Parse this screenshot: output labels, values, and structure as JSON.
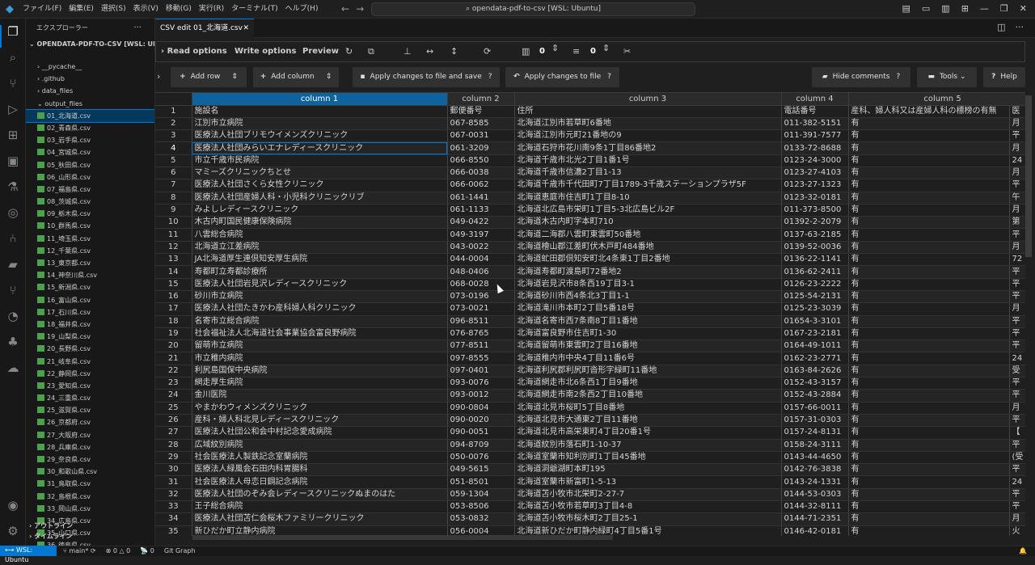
{
  "titlebar": {
    "menu": [
      "ファイル(F)",
      "編集(E)",
      "選択(S)",
      "表示(V)",
      "移動(G)",
      "実行(R)",
      "ターミナル(T)",
      "ヘルプ(H)"
    ],
    "search": "opendata-pdf-to-csv [WSL: Ubuntu]"
  },
  "sidebar": {
    "title": "エクスプローラー",
    "project": "OPENDATA-PDF-TO-CSV [WSL: UBUNT...",
    "items": [
      {
        "label": "__pycache__",
        "type": "folder"
      },
      {
        "label": ".github",
        "type": "folder"
      },
      {
        "label": "data_files",
        "type": "folder"
      },
      {
        "label": "output_files",
        "type": "folder-open"
      },
      {
        "label": "01_北海道.csv",
        "type": "csv",
        "selected": true
      },
      {
        "label": "02_青森県.csv",
        "type": "csv"
      },
      {
        "label": "03_岩手県.csv",
        "type": "csv"
      },
      {
        "label": "04_宮城県.csv",
        "type": "csv"
      },
      {
        "label": "05_秋田県.csv",
        "type": "csv"
      },
      {
        "label": "06_山形県.csv",
        "type": "csv"
      },
      {
        "label": "07_福島県.csv",
        "type": "csv"
      },
      {
        "label": "08_茨城県.csv",
        "type": "csv"
      },
      {
        "label": "09_栃木県.csv",
        "type": "csv"
      },
      {
        "label": "10_群馬県.csv",
        "type": "csv"
      },
      {
        "label": "11_埼玉県.csv",
        "type": "csv"
      },
      {
        "label": "12_千葉県.csv",
        "type": "csv"
      },
      {
        "label": "13_東京都.csv",
        "type": "csv"
      },
      {
        "label": "14_神奈川県.csv",
        "type": "csv"
      },
      {
        "label": "15_新潟県.csv",
        "type": "csv"
      },
      {
        "label": "16_富山県.csv",
        "type": "csv"
      },
      {
        "label": "17_石川県.csv",
        "type": "csv"
      },
      {
        "label": "18_福井県.csv",
        "type": "csv"
      },
      {
        "label": "19_山梨県.csv",
        "type": "csv"
      },
      {
        "label": "20_長野県.csv",
        "type": "csv"
      },
      {
        "label": "21_岐阜県.csv",
        "type": "csv"
      },
      {
        "label": "22_静岡県.csv",
        "type": "csv"
      },
      {
        "label": "23_愛知県.csv",
        "type": "csv"
      },
      {
        "label": "24_三重県.csv",
        "type": "csv"
      },
      {
        "label": "25_滋賀県.csv",
        "type": "csv"
      },
      {
        "label": "26_京都府.csv",
        "type": "csv"
      },
      {
        "label": "27_大阪府.csv",
        "type": "csv"
      },
      {
        "label": "28_兵庫県.csv",
        "type": "csv"
      },
      {
        "label": "29_奈良県.csv",
        "type": "csv"
      },
      {
        "label": "30_和歌山県.csv",
        "type": "csv"
      },
      {
        "label": "31_鳥取県.csv",
        "type": "csv"
      },
      {
        "label": "32_島根県.csv",
        "type": "csv"
      },
      {
        "label": "33_岡山県.csv",
        "type": "csv"
      },
      {
        "label": "34_広島県.csv",
        "type": "csv"
      },
      {
        "label": "35_山口県.csv",
        "type": "csv"
      },
      {
        "label": "36_徳島県.csv",
        "type": "csv"
      }
    ],
    "outline": "アウトライン",
    "timeline": "タイムライン"
  },
  "editor": {
    "tab_label": "CSV edit 01_北海道.csv",
    "options": {
      "read": "Read options",
      "write": "Write options",
      "preview": "Preview",
      "count_a": "0",
      "count_b": "0"
    },
    "buttons": {
      "add_row": "Add row",
      "add_column": "Add column",
      "apply_save": "Apply changes to file and save",
      "apply": "Apply changes to file",
      "hide_comments": "Hide comments",
      "tools": "Tools",
      "help": "Help"
    },
    "columns": [
      "column 1",
      "column 2",
      "column 3",
      "column 4",
      "column 5"
    ],
    "rows": [
      [
        "1",
        "施設名",
        "郵便番号",
        "住所",
        "電話番号",
        "産科、婦人科又は産婦人科の標榜の有無",
        "医"
      ],
      [
        "2",
        "江別市立病院",
        "067-8585",
        "北海道江別市若草町6番地",
        "011-382-5151",
        "有",
        "月"
      ],
      [
        "3",
        "医療法人社団ブリモウイメンズクリニック",
        "067-0031",
        "北海道江別市元町21番地の9",
        "011-391-7577",
        "有",
        "平"
      ],
      [
        "4",
        "医療法人社団みらいエナレディースクリニック",
        "061-3209",
        "北海道石狩市花川南9条1丁目86番地2",
        "0133-72-8688",
        "有",
        "月"
      ],
      [
        "5",
        "市立千歳市民病院",
        "066-8550",
        "北海道千歳市北光2丁目1番1号",
        "0123-24-3000",
        "有",
        "24"
      ],
      [
        "6",
        "マミーズクリニックちとせ",
        "066-0038",
        "北海道千歳市信濃2丁目1-13",
        "0123-27-4103",
        "有",
        "月"
      ],
      [
        "7",
        "医療法人社団さくら女性クリニック",
        "066-0062",
        "北海道千歳市千代田町7丁目1789-3千歳ステーションプラザ5F",
        "0123-27-1323",
        "有",
        "平"
      ],
      [
        "8",
        "医療法人社団産婦人科・小児科クリニックリブ",
        "061-1441",
        "北海道恵庭市住吉町1丁目8-10",
        "0123-32-0181",
        "有",
        "午"
      ],
      [
        "9",
        "みよしレディースクリニック",
        "061-1133",
        "北海道北広島市栄町1丁目5-3北広島ビル2F",
        "011-373-8500",
        "有",
        "月"
      ],
      [
        "10",
        "木古内町国民健康保険病院",
        "049-0422",
        "北海道木古内町字本町710",
        "01392-2-2079",
        "有",
        "第"
      ],
      [
        "11",
        "八雲総合病院",
        "049-3197",
        "北海道二海郡八雲町東雲町50番地",
        "0137-63-2185",
        "有",
        "平"
      ],
      [
        "12",
        "北海道立江差病院",
        "043-0022",
        "北海道檜山郡江差町伏木戸町484番地",
        "0139-52-0036",
        "有",
        "月"
      ],
      [
        "13",
        "JA北海道厚生連倶知安厚生病院",
        "044-0004",
        "北海道虻田郡倶知安町北4条東1丁目2番地",
        "0136-22-1141",
        "有",
        "72"
      ],
      [
        "14",
        "寿都町立寿都診療所",
        "048-0406",
        "北海道寿都町渡島町72番地2",
        "0136-62-2411",
        "有",
        "平"
      ],
      [
        "15",
        "医療法人社団岩見沢レディースクリニック",
        "068-0028",
        "北海道岩見沢市8条西19丁目3-1",
        "0126-23-2222",
        "有",
        "平"
      ],
      [
        "16",
        "砂川市立病院",
        "073-0196",
        "北海道砂川市西4条北3丁目1-1",
        "0125-54-2131",
        "有",
        "平"
      ],
      [
        "17",
        "医療法人社団たきかわ産科婦人科クリニック",
        "073-0021",
        "北海道滝川市本町2丁目5番18号",
        "0125-23-3039",
        "有",
        "月"
      ],
      [
        "18",
        "名寄市立総合病院",
        "096-8511",
        "北海道名寄市西7条南8丁目1番地",
        "01654-3-3101",
        "有",
        "平"
      ],
      [
        "19",
        "社会福祉法人北海道社会事業協会富良野病院",
        "076-8765",
        "北海道富良野市住吉町1-30",
        "0167-23-2181",
        "有",
        "平"
      ],
      [
        "20",
        "留萌市立病院",
        "077-8511",
        "北海道留萌市東雲町2丁目16番地",
        "0164-49-1011",
        "有",
        "平"
      ],
      [
        "21",
        "市立稚内病院",
        "097-8555",
        "北海道稚内市中央4丁目11番6号",
        "0162-23-2771",
        "有",
        "24"
      ],
      [
        "22",
        "利尻島国保中央病院",
        "097-0401",
        "北海道利尻郡利尻町沓形字緑町11番地",
        "0163-84-2626",
        "有",
        "受"
      ],
      [
        "23",
        "網走厚生病院",
        "093-0076",
        "北海道網走市北6条西1丁目9番地",
        "0152-43-3157",
        "有",
        "平"
      ],
      [
        "24",
        "金川医院",
        "093-0012",
        "北海道網走市南2条西2丁目10番地",
        "0152-43-2884",
        "有",
        "平"
      ],
      [
        "25",
        "やまかわウィメンズクリニック",
        "090-0804",
        "北海道北見市桜町5丁目8番地",
        "0157-66-0011",
        "有",
        "月"
      ],
      [
        "26",
        "産科・婦人科北見レディースクリニック",
        "090-0020",
        "北海道北見市大通東2丁目11番地",
        "0157-31-0303",
        "有",
        "平"
      ],
      [
        "27",
        "医療法人社団公和会中村記念愛成病院",
        "090-0051",
        "北海道北見市高栄東町4丁目20番1号",
        "0157-24-8131",
        "有",
        "【"
      ],
      [
        "28",
        "広域紋別病院",
        "094-8709",
        "北海道紋別市落石町1-10-37",
        "0158-24-3111",
        "有",
        "平"
      ],
      [
        "29",
        "社会医療法人製鉄記念室蘭病院",
        "050-0076",
        "北海道室蘭市知利別町1丁目45番地",
        "0143-44-4650",
        "有",
        "(受"
      ],
      [
        "30",
        "医療法人緑風会石田内科胃腸科",
        "049-5615",
        "北海道洞爺湖町本町195",
        "0142-76-3838",
        "有",
        "平"
      ],
      [
        "31",
        "社会医療法人母恋日鋼記念病院",
        "051-8501",
        "北海道室蘭市新富町1-5-13",
        "0143-24-1331",
        "有",
        "24"
      ],
      [
        "32",
        "医療法人社団のぞみ会レディースクリニックぬまのはた",
        "059-1304",
        "北海道苫小牧市北栄町2-27-7",
        "0144-53-0303",
        "有",
        "平"
      ],
      [
        "33",
        "王子総合病院",
        "053-8506",
        "北海道苫小牧市若草町3丁目4-8",
        "0144-32-8111",
        "有",
        "平"
      ],
      [
        "34",
        "医療法人社団苫仁会桜木ファミリークリニック",
        "053-0832",
        "北海道苫小牧市桜木町2丁目25-1",
        "0144-71-2351",
        "有",
        "月"
      ],
      [
        "35",
        "新ひだか町立静内病院",
        "056-0004",
        "北海道新ひだか町静内緑町4丁目5番1号",
        "0146-42-0181",
        "有",
        "火"
      ]
    ]
  },
  "statusbar": {
    "remote": "WSL: Ubuntu",
    "branch": "main*",
    "problems": "0 △ 0",
    "ports": "0",
    "git_graph": "Git Graph"
  }
}
